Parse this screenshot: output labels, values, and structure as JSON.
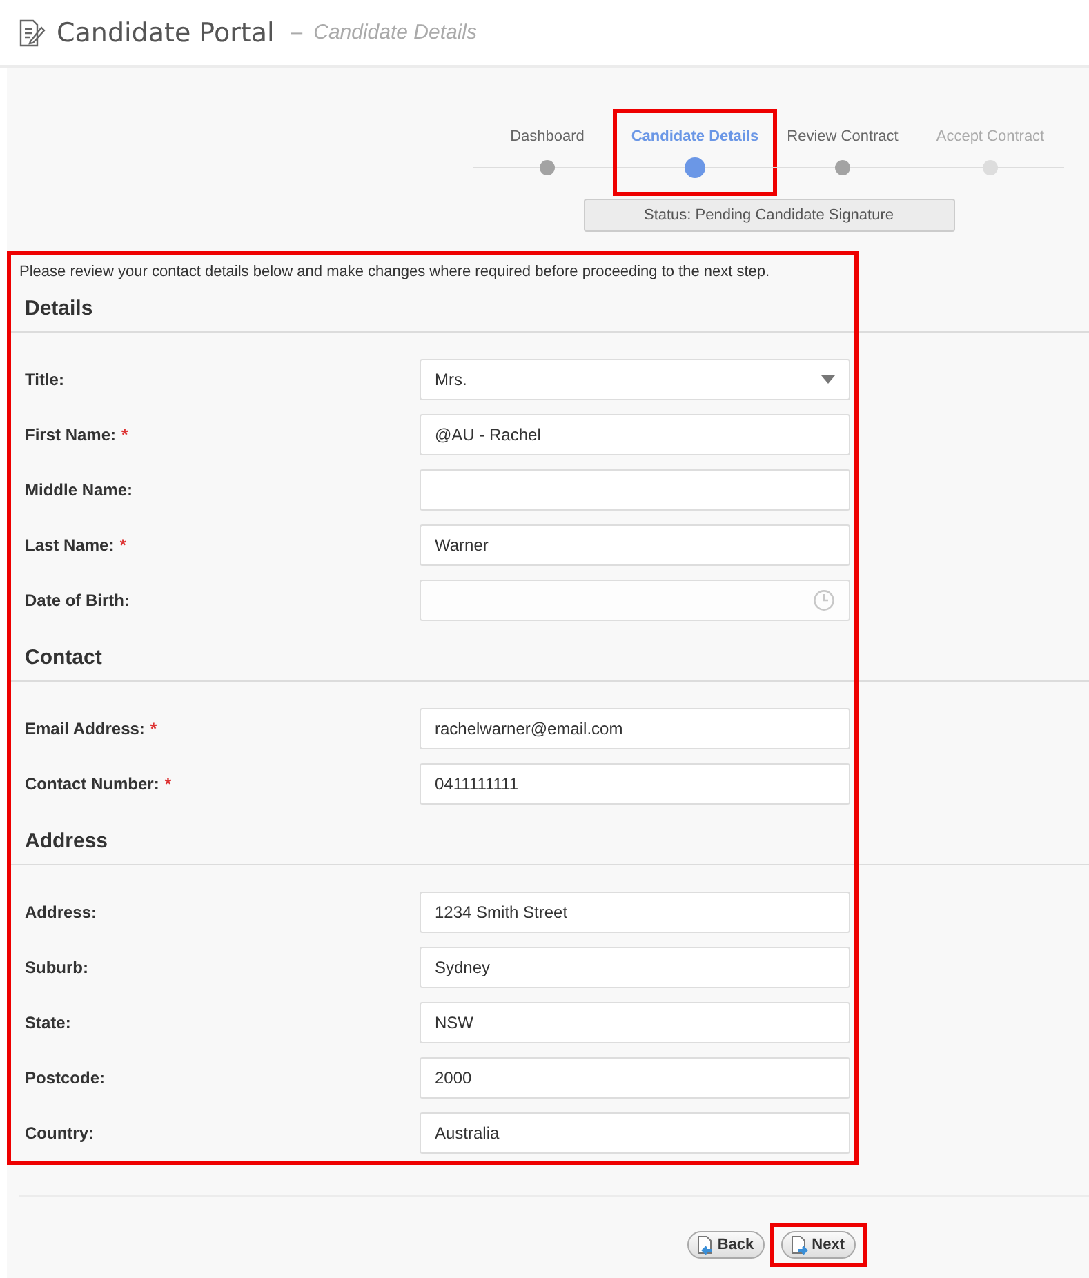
{
  "header": {
    "title": "Candidate Portal",
    "separator": "–",
    "subtitle": "Candidate Details"
  },
  "steps": [
    {
      "label": "Dashboard",
      "selected": false,
      "disabled": false,
      "highlighted": false
    },
    {
      "label": "Candidate Details",
      "selected": true,
      "disabled": false,
      "highlighted": true
    },
    {
      "label": "Review Contract",
      "selected": false,
      "disabled": false,
      "highlighted": false
    },
    {
      "label": "Accept Contract",
      "selected": false,
      "disabled": true,
      "highlighted": false
    }
  ],
  "status": "Status: Pending Candidate Signature",
  "form": {
    "highlighted": true,
    "intro": "Please review your contact details below and make changes where required before proceeding to the next step.",
    "sections": [
      {
        "heading": "Details",
        "fields": [
          {
            "label": "Title:",
            "kind": "select",
            "value": "Mrs."
          },
          {
            "label": "First Name:",
            "required_mark": "*",
            "kind": "text",
            "value": "@AU - Rachel"
          },
          {
            "label": "Middle Name:",
            "kind": "text"
          },
          {
            "label": "Last Name:",
            "required_mark": "*",
            "kind": "text",
            "value": "Warner"
          },
          {
            "label": "Date of Birth:",
            "kind": "date"
          }
        ]
      },
      {
        "heading": "Contact",
        "fields": [
          {
            "label": "Email Address:",
            "required_mark": "*",
            "kind": "text",
            "value": "rachelwarner@email.com"
          },
          {
            "label": "Contact Number:",
            "required_mark": "*",
            "kind": "text",
            "value": "0411111111"
          }
        ]
      },
      {
        "heading": "Address",
        "fields": [
          {
            "label": "Address:",
            "kind": "text",
            "value": "1234 Smith Street"
          },
          {
            "label": "Suburb:",
            "kind": "text",
            "value": "Sydney"
          },
          {
            "label": "State:",
            "kind": "text",
            "value": "NSW"
          },
          {
            "label": "Postcode:",
            "kind": "text",
            "value": "2000"
          },
          {
            "label": "Country:",
            "kind": "text",
            "value": "Australia"
          }
        ]
      }
    ]
  },
  "buttons": [
    {
      "label": "Back",
      "kind": "back",
      "highlighted": false
    },
    {
      "label": "Next",
      "kind": "next",
      "highlighted": true
    }
  ]
}
